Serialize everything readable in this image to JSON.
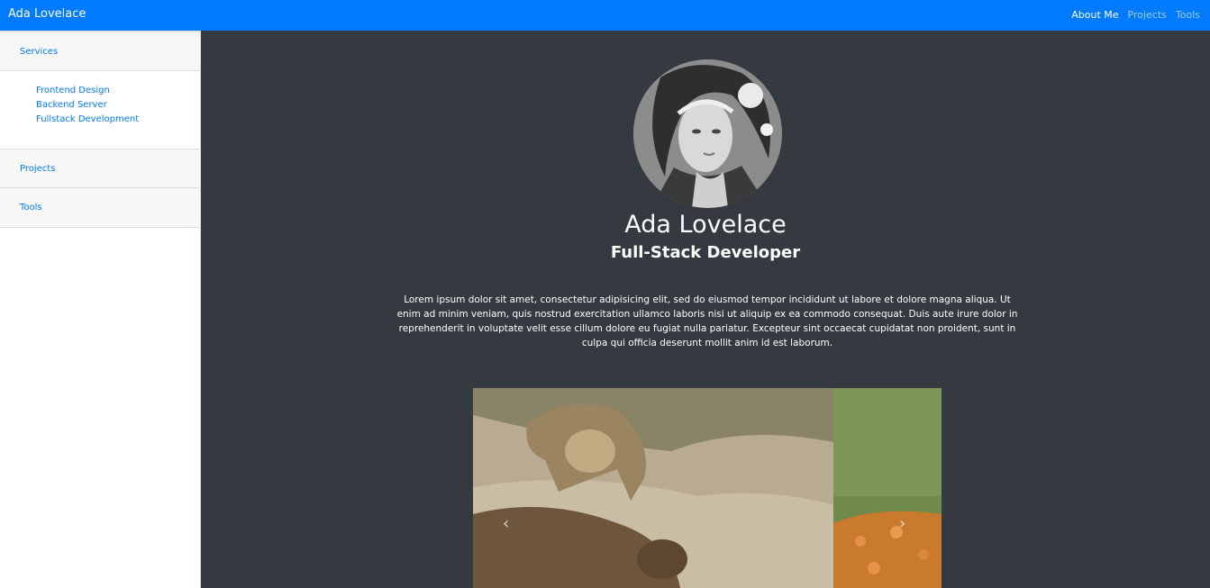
{
  "navbar": {
    "brand": "Ada Lovelace",
    "links": [
      "About Me",
      "Projects",
      "Tools"
    ]
  },
  "sidebar": {
    "sections": [
      {
        "title": "Services",
        "items": [
          "Frontend Design",
          "Backend Server",
          "Fullstack Development"
        ]
      },
      {
        "title": "Projects"
      },
      {
        "title": "Tools"
      }
    ]
  },
  "profile": {
    "name": "Ada Lovelace",
    "role": "Full-Stack Developer",
    "bio": "Lorem ipsum dolor sit amet, consectetur adipisicing elit, sed do eiusmod tempor incididunt ut labore et dolore magna aliqua. Ut enim ad minim veniam, quis nostrud exercitation ullamco laboris nisi ut aliquip ex ea commodo consequat. Duis aute irure dolor in reprehenderit in voluptate velit esse cillum dolore eu fugiat nulla pariatur. Excepteur sint occaecat cupidatat non proident, sunt in culpa qui officia deserunt mollit anim id est laborum."
  },
  "carousel": {
    "prev_icon": "‹",
    "next_icon": "›"
  },
  "colors": {
    "primary": "#007bff",
    "main_bg": "#343a40",
    "sidebar_bg": "#ffffff"
  }
}
